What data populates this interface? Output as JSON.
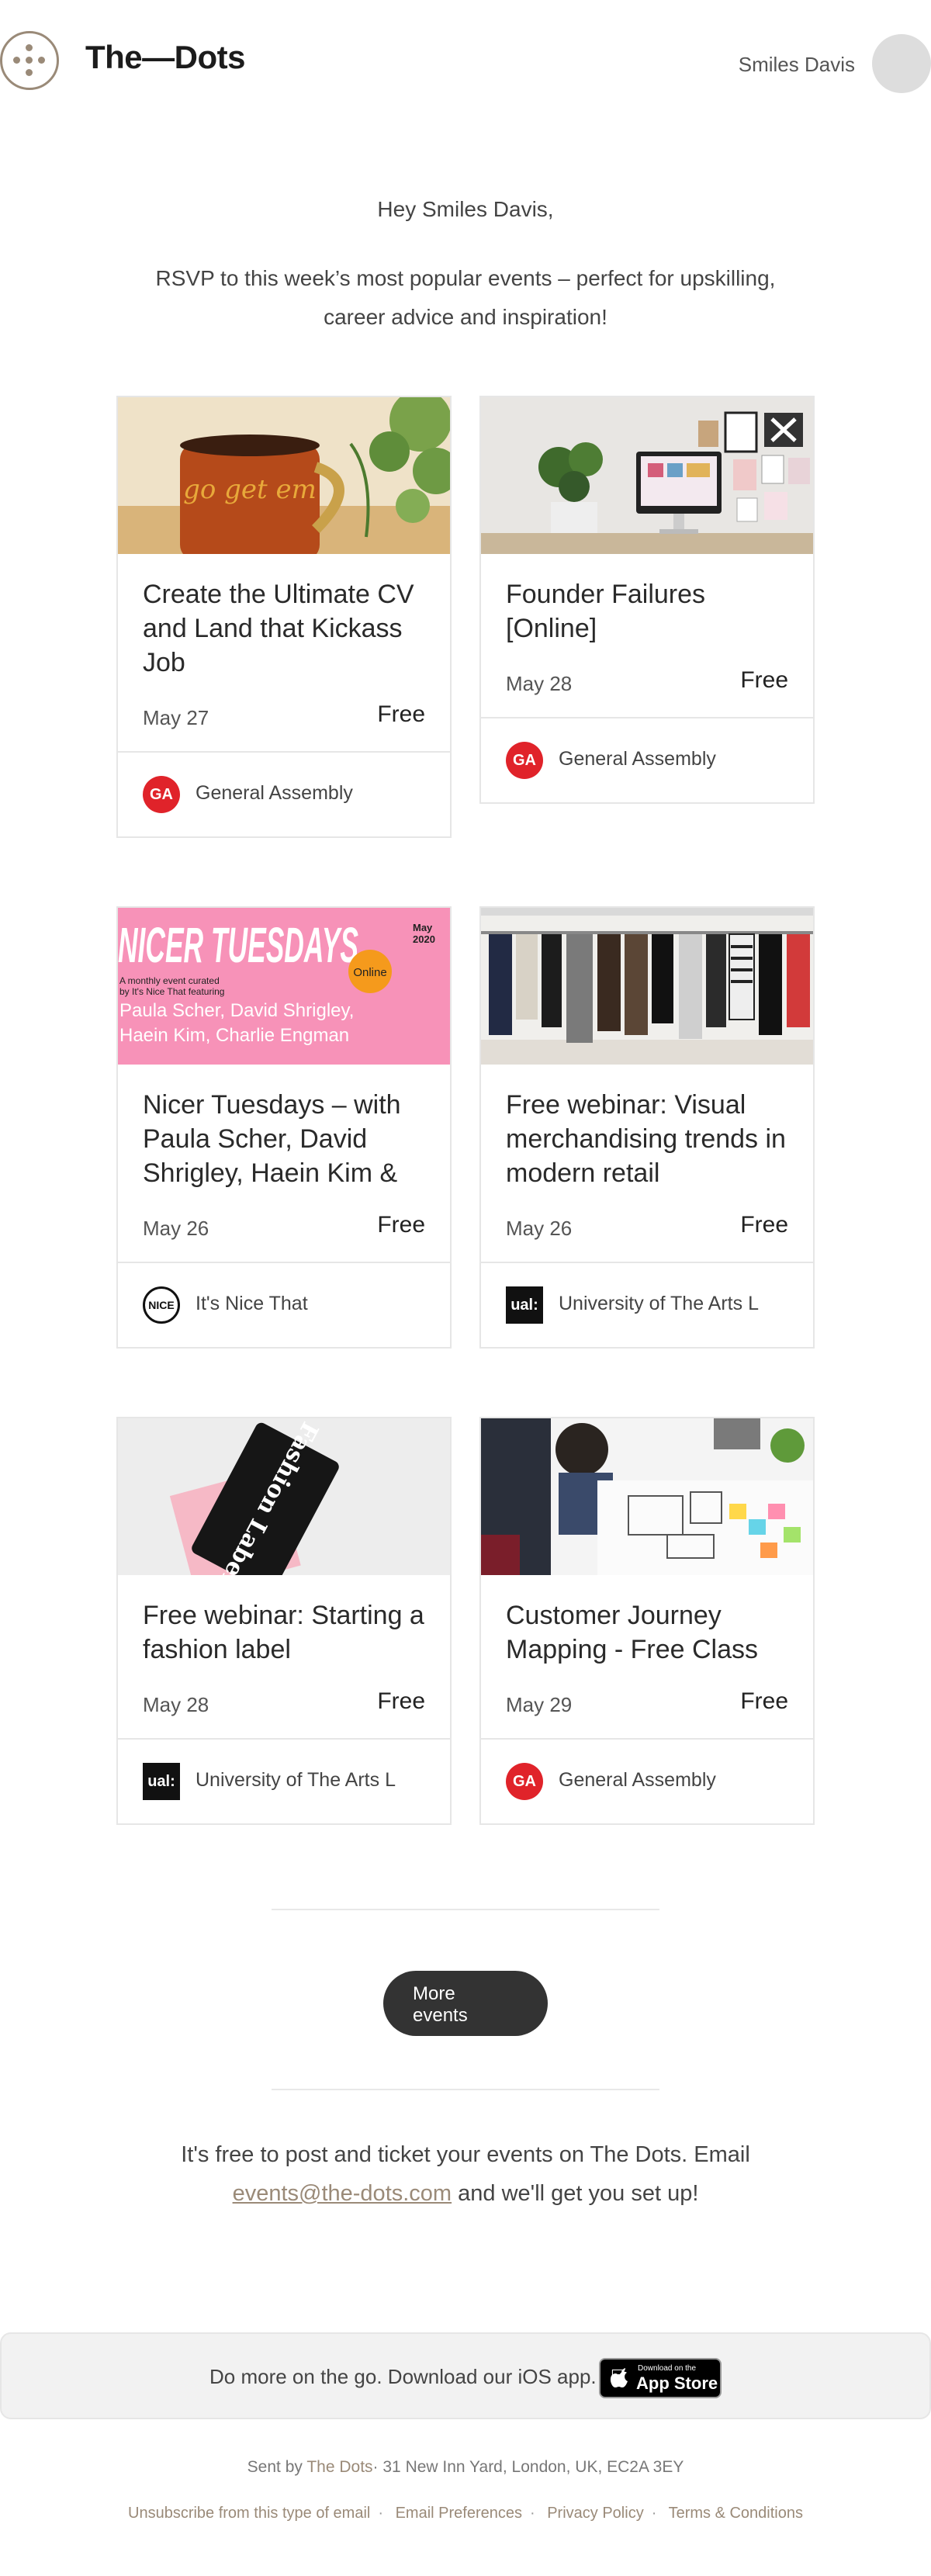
{
  "header": {
    "brand": "The—Dots",
    "user_name": "Smiles Davis"
  },
  "intro": {
    "greeting": "Hey Smiles Davis,",
    "message": "RSVP to this week’s most popular events – perfect for upskilling, career advice and inspiration!"
  },
  "events": [
    {
      "title": "Create the Ultimate CV and Land that Kickass Job",
      "date": "May 27",
      "price": "Free",
      "organizer": "General Assembly",
      "organizer_logo": "GA",
      "image": "coffee-mug-photo",
      "mug_text": "go get em"
    },
    {
      "title": "Founder Failures [Online]",
      "date": "May 28",
      "price": "Free",
      "organizer": "General Assembly",
      "organizer_logo": "GA",
      "image": "desk-workspace-photo"
    },
    {
      "title": "Nicer Tuesdays – with Paula Scher, David Shrigley, Haein Kim &",
      "date": "May 26",
      "price": "Free",
      "organizer": "It's Nice That",
      "organizer_logo": "NICE",
      "image": "nicer-tuesdays-poster",
      "poster": {
        "headline": "NICER TUESDAYS",
        "month": "May",
        "year": "2020",
        "badge": "Online",
        "tagline_line1": "A monthly event curated",
        "tagline_line2": "by It's Nice That featuring",
        "speakers_line1": "Paula Scher, David Shrigley,",
        "speakers_line2": "Haein Kim, Charlie Engman"
      }
    },
    {
      "title": "Free webinar: Visual merchandising trends in modern retail",
      "date": "May 26",
      "price": "Free",
      "organizer": "University of The Arts L",
      "organizer_logo": "ual:",
      "image": "clothing-rack-photo"
    },
    {
      "title": "Free webinar: Starting a fashion label",
      "date": "May 28",
      "price": "Free",
      "organizer": "University of The Arts L",
      "organizer_logo": "ual:",
      "image": "fashion-label-tag-photo",
      "tag_text": "Fashion Label"
    },
    {
      "title": "Customer Journey Mapping - Free Class",
      "date": "May 29",
      "price": "Free",
      "organizer": "General Assembly",
      "organizer_logo": "GA",
      "image": "journey-mapping-photo"
    }
  ],
  "more_button": {
    "label_line1": "More",
    "label_line2": "events"
  },
  "post_events": {
    "text_before": "It's free to post and ticket your events on The Dots. Email",
    "email": "events@the-dots.com",
    "text_after": "and we'll get you set up!"
  },
  "app_banner": {
    "text": "Do more on the go. Download our iOS app.",
    "badge_small": "Download on the",
    "badge_big": "App Store"
  },
  "footer": {
    "sent_by_prefix": "Sent by",
    "sent_by_brand": "The Dots",
    "address": "· 31 New Inn Yard, London, UK, EC2A 3EY",
    "links": [
      "Unsubscribe from this type of email",
      "Email Preferences",
      "Privacy Policy",
      "Terms & Conditions"
    ]
  },
  "colors": {
    "accent": "#9a8a78",
    "button": "#333333",
    "ga_red": "#e0232a",
    "poster_pink": "#f792b8",
    "poster_orange": "#f59a1c"
  }
}
